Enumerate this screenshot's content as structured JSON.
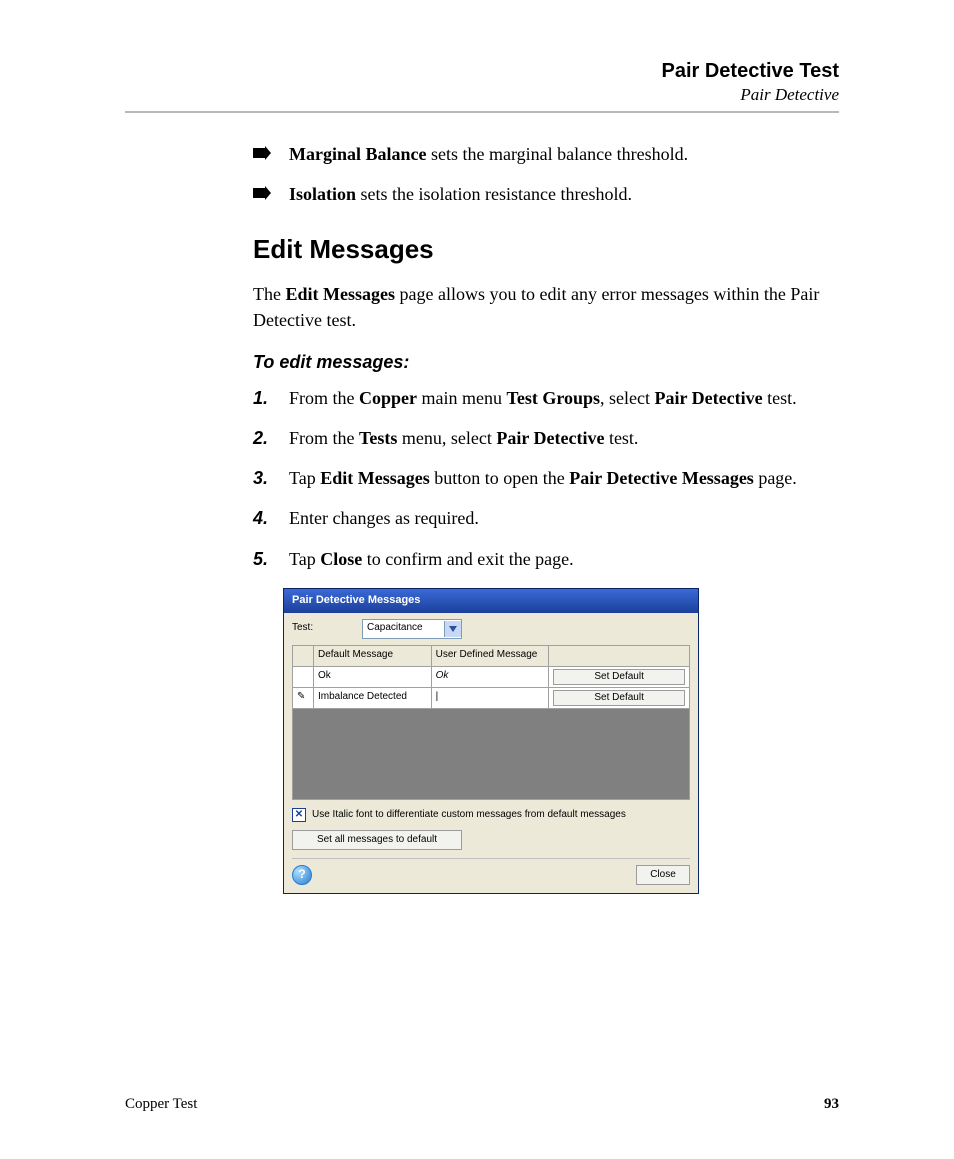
{
  "header": {
    "title": "Pair Detective Test",
    "subtitle": "Pair Detective"
  },
  "bullets": {
    "b1_bold": "Marginal Balance",
    "b1_rest": " sets the marginal balance threshold.",
    "b2_bold": "Isolation",
    "b2_rest": " sets the isolation resistance threshold."
  },
  "section": {
    "heading": "Edit Messages",
    "para_pre": "The ",
    "para_bold": "Edit Messages",
    "para_post": " page allows you to edit any error messages within the Pair Detective test."
  },
  "procedure": {
    "title": "To edit messages:",
    "s1": {
      "pre": "From the ",
      "b1": "Copper",
      "mid1": " main menu ",
      "b2": "Test Groups",
      "mid2": ", select ",
      "b3": "Pair Detective",
      "post": " test."
    },
    "s2": {
      "pre": "From the ",
      "b1": "Tests",
      "mid": " menu, select ",
      "b2": "Pair Detective",
      "post": " test."
    },
    "s3": {
      "pre": "Tap ",
      "b1": "Edit Messages",
      "mid": " button to open the ",
      "b2": "Pair Detective Messages",
      "post": " page."
    },
    "s4": "Enter changes as required.",
    "s5": {
      "pre": "Tap ",
      "b1": "Close",
      "post": " to confirm and exit the page."
    },
    "nums": {
      "n1": "1.",
      "n2": "2.",
      "n3": "3.",
      "n4": "4.",
      "n5": "5."
    }
  },
  "dialog": {
    "title": "Pair Detective Messages",
    "test_label": "Test:",
    "test_value": "Capacitance",
    "columns": {
      "icon": "",
      "default": "Default Message",
      "user": "User Defined Message",
      "action": ""
    },
    "rows": [
      {
        "icon": "",
        "default": "Ok",
        "user": "Ok",
        "user_italic": true,
        "action": "Set Default"
      },
      {
        "icon": "✎",
        "default": "Imbalance Detected",
        "user": "|",
        "user_italic": false,
        "action": "Set Default"
      }
    ],
    "checkbox_label": "Use Italic font to differentiate custom messages from default messages",
    "checkbox_mark": "✕",
    "set_all": "Set all messages to default",
    "help": "?",
    "close": "Close"
  },
  "footer": {
    "left": "Copper Test",
    "right": "93"
  }
}
